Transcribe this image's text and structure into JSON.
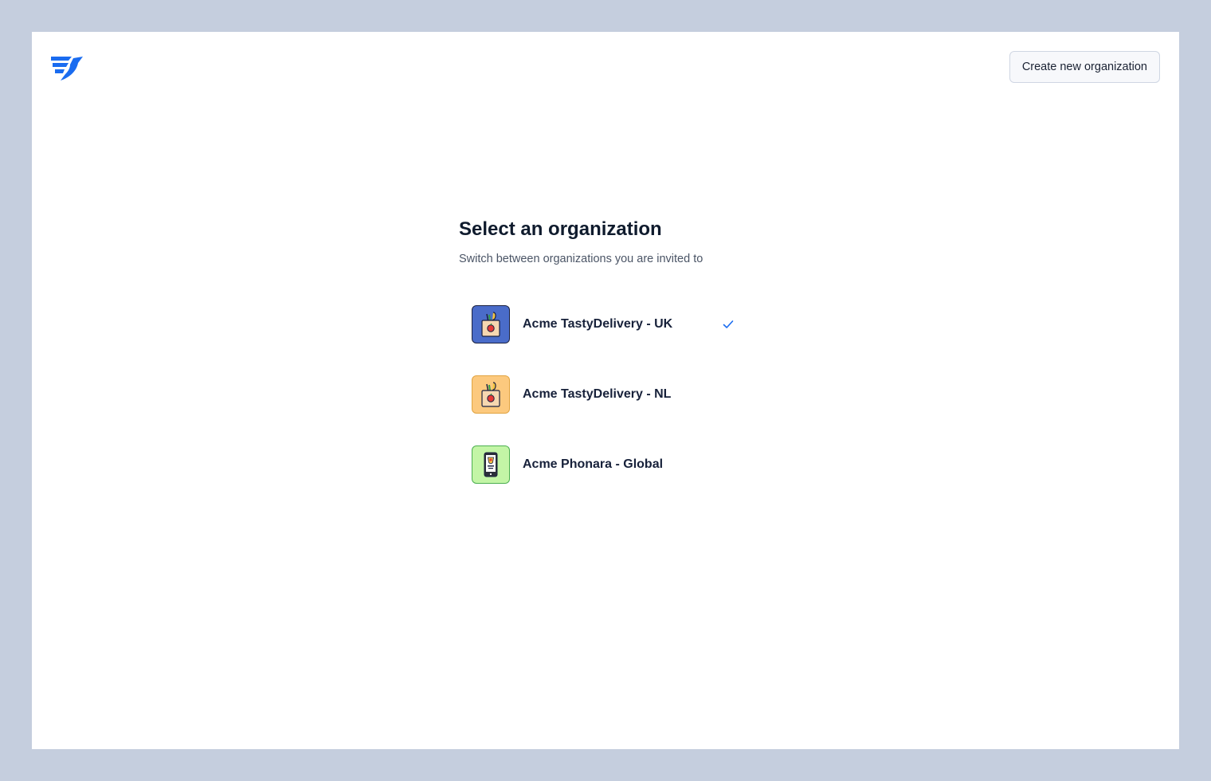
{
  "header": {
    "logo_icon": "messagebird-logo-icon",
    "create_button_label": "Create new organization"
  },
  "main": {
    "title": "Select an organization",
    "subtitle": "Switch between organizations you are invited to"
  },
  "organizations": [
    {
      "name": "Acme TastyDelivery - UK",
      "icon": "grocery-bag-icon",
      "avatar_bg": "#4a6cc9",
      "selected": true
    },
    {
      "name": "Acme TastyDelivery - NL",
      "icon": "grocery-bag-icon",
      "avatar_bg": "#fcc97e",
      "selected": false
    },
    {
      "name": "Acme Phonara - Global",
      "icon": "mobile-phone-icon",
      "avatar_bg": "#c3f5a6",
      "selected": false
    }
  ],
  "colors": {
    "brand": "#1a6cf0",
    "check": "#1a6cf0",
    "frame_bg": "#c5cede"
  }
}
